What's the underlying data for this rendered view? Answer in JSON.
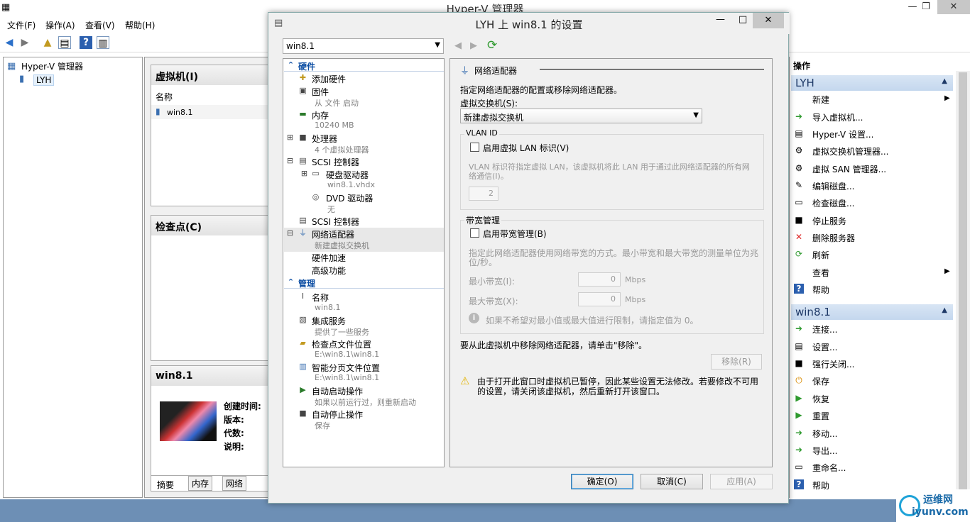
{
  "main": {
    "title": "Hyper-V 管理器",
    "menu": [
      "文件(F)",
      "操作(A)",
      "查看(V)",
      "帮助(H)"
    ],
    "tree_root": "Hyper-V 管理器",
    "tree_host": "LYH",
    "vm_panel_title": "虚拟机(I)",
    "vm_col_name": "名称",
    "vm_row": "win8.1",
    "checkpoint_title": "检查点(C)",
    "detail_title": "win8.1",
    "detail_fields": [
      "创建时间:",
      "版本:",
      "代数:",
      "说明:"
    ],
    "detail_tabs": [
      "摘要",
      "内存",
      "网络"
    ]
  },
  "actions": {
    "header": "操作",
    "section1": "LYH",
    "items1": [
      "新建",
      "导入虚拟机...",
      "Hyper-V 设置...",
      "虚拟交换机管理器...",
      "虚拟 SAN 管理器...",
      "编辑磁盘...",
      "检查磁盘...",
      "停止服务",
      "删除服务器",
      "刷新",
      "查看",
      "帮助"
    ],
    "section2": "win8.1",
    "items2": [
      "连接...",
      "设置...",
      "强行关闭...",
      "保存",
      "恢复",
      "重置",
      "移动...",
      "导出...",
      "重命名...",
      "帮助"
    ]
  },
  "dialog": {
    "title": "LYH 上 win8.1 的设置",
    "vm_select": "win8.1",
    "tree": {
      "hardware_header": "硬件",
      "add_hw": "添加硬件",
      "firmware": "固件",
      "firmware_sub": "从 文件 启动",
      "memory": "内存",
      "memory_sub": "10240 MB",
      "cpu": "处理器",
      "cpu_sub": "4 个虚拟处理器",
      "scsi1": "SCSI 控制器",
      "hdd": "硬盘驱动器",
      "hdd_sub": "win8.1.vhdx",
      "dvd": "DVD 驱动器",
      "dvd_sub": "无",
      "scsi2": "SCSI 控制器",
      "nic": "网络适配器",
      "nic_sub": "新建虚拟交换机",
      "hw_accel": "硬件加速",
      "advanced": "高级功能",
      "mgmt_header": "管理",
      "name": "名称",
      "name_sub": "win8.1",
      "integration": "集成服务",
      "integration_sub": "提供了一些服务",
      "ckpt_loc": "检查点文件位置",
      "ckpt_loc_sub": "E:\\win8.1\\win8.1",
      "paging_loc": "智能分页文件位置",
      "paging_loc_sub": "E:\\win8.1\\win8.1",
      "auto_start": "自动启动操作",
      "auto_start_sub": "如果以前运行过，则重新启动",
      "auto_stop": "自动停止操作",
      "auto_stop_sub": "保存"
    },
    "content": {
      "section_title": "网络适配器",
      "desc": "指定网络适配器的配置或移除网络适配器。",
      "switch_label": "虚拟交换机(S):",
      "switch_value": "新建虚拟交换机",
      "vlan_group": "VLAN ID",
      "vlan_check": "启用虚拟 LAN 标识(V)",
      "vlan_desc": "VLAN 标识符指定虚拟 LAN，该虚拟机将此 LAN 用于通过此网络适配器的所有网络通信(I)。",
      "vlan_value": "2",
      "bw_group": "带宽管理",
      "bw_check": "启用带宽管理(B)",
      "bw_desc": "指定此网络适配器使用网络带宽的方式。最小带宽和最大带宽的测量单位为兆位/秒。",
      "min_label": "最小带宽(I):",
      "min_value": "0",
      "max_label": "最大带宽(X):",
      "max_value": "0",
      "unit": "Mbps",
      "bw_info": "如果不希望对最小值或最大值进行限制，请指定值为 0。",
      "remove_desc": "要从此虚拟机中移除网络适配器，请单击\"移除\"。",
      "remove_btn": "移除(R)",
      "warning": "由于打开此窗口时虚拟机已暂停，因此某些设置无法修改。若要修改不可用的设置，请关闭该虚拟机，然后重新打开该窗口。"
    },
    "buttons": {
      "ok": "确定(O)",
      "cancel": "取消(C)",
      "apply": "应用(A)"
    }
  },
  "watermark": {
    "text": "运维网",
    "url": "iyunv.com"
  },
  "colors": {
    "accent": "#0d4ea3",
    "section_bg": "#c4d7ee",
    "close_btn": "#c7c7c7"
  }
}
